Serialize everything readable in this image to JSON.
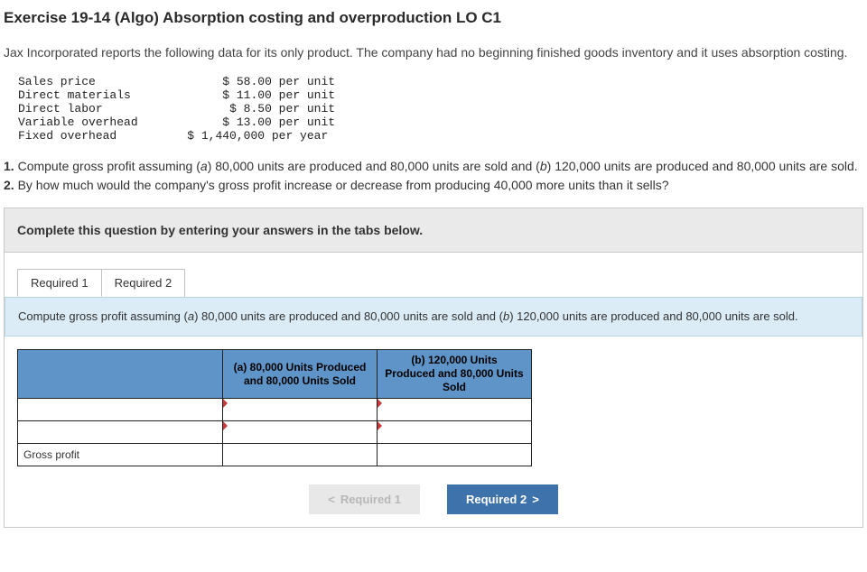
{
  "title": "Exercise 19-14 (Algo) Absorption costing and overproduction LO C1",
  "intro": "Jax Incorporated reports the following data for its only product. The company had no beginning finished goods inventory and it uses absorption costing.",
  "mono": {
    "r1l": "Sales price",
    "r1r": "$ 58.00 per unit",
    "r2l": "Direct materials",
    "r2r": "$ 11.00 per unit",
    "r3l": "Direct labor",
    "r3r": "$ 8.50 per unit",
    "r4l": "Variable overhead",
    "r4r": "$ 13.00 per unit",
    "r5l": "Fixed overhead",
    "r5r": "$ 1,440,000 per year"
  },
  "q1_lead": "1.",
  "q1_text_a": " Compute gross profit assuming (",
  "q1_a_letter": "a",
  "q1_text_b": ") 80,000 units are produced and 80,000 units are sold and (",
  "q1_b_letter": "b",
  "q1_text_c": ") 120,000 units are produced and 80,000 units are sold.",
  "q2_lead": "2.",
  "q2_text": " By how much would the company's gross profit increase or decrease from producing 40,000 more units than it sells?",
  "instruct": "Complete this question by entering your answers in the tabs below.",
  "tabs": {
    "t1": "Required 1",
    "t2": "Required 2"
  },
  "subprompt_a": "Compute gross profit assuming (",
  "sub_a": "a",
  "subprompt_b": ") 80,000 units are produced and 80,000 units are sold and (",
  "sub_b": "b",
  "subprompt_c": ") 120,000 units are produced and 80,000 units are sold.",
  "table": {
    "colA": "(a) 80,000 Units Produced and 80,000 Units Sold",
    "colB": "(b) 120,000 Units Produced and 80,000 Units Sold",
    "row3_label": "Gross profit"
  },
  "nav": {
    "prev_chev": "<",
    "prev": "Required 1",
    "next": "Required 2",
    "next_chev": ">"
  }
}
